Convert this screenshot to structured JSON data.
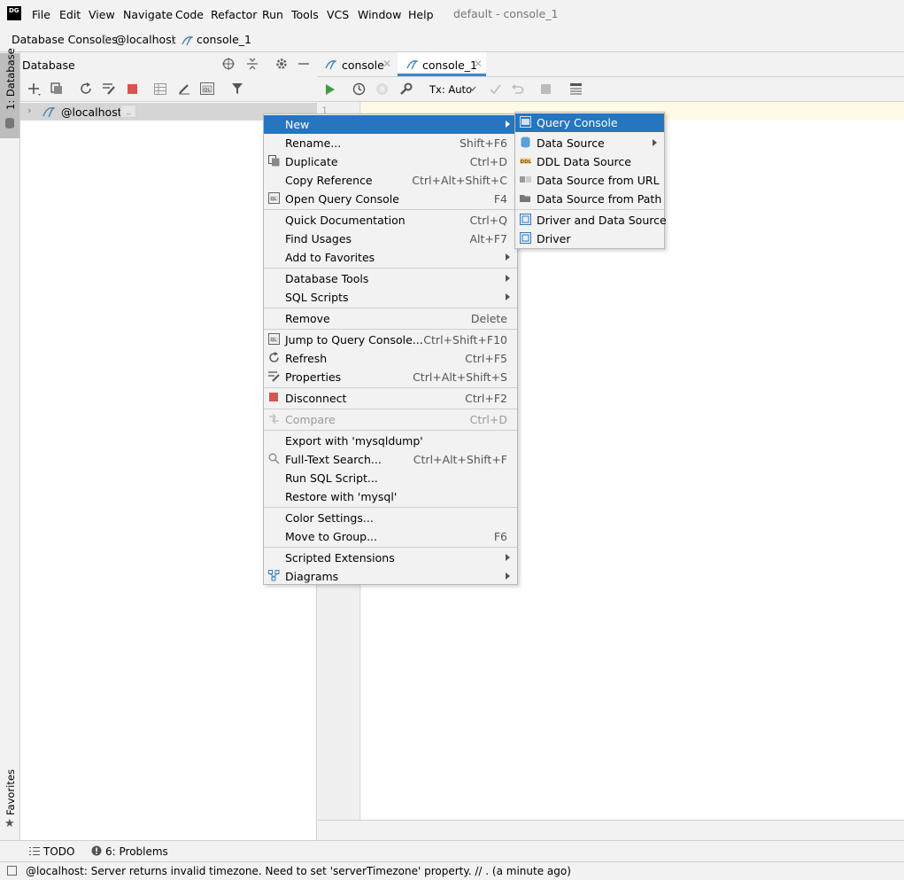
{
  "app": {
    "logo_text": "DG",
    "window_title": "default - console_1"
  },
  "menubar": {
    "items": [
      "File",
      "Edit",
      "View",
      "Navigate",
      "Code",
      "Refactor",
      "Run",
      "Tools",
      "VCS",
      "Window",
      "Help"
    ]
  },
  "breadcrumb": {
    "items": [
      "Database Consoles",
      "@localhost",
      "console_1"
    ]
  },
  "left_stripe": {
    "database_tab": "1: Database",
    "favorites_tab": "Favorites"
  },
  "db_panel": {
    "title": "Database",
    "tree": [
      {
        "label": "@localhost",
        "badge": "_"
      }
    ]
  },
  "editor": {
    "tabs": [
      {
        "label": "console"
      },
      {
        "label": "console_1"
      }
    ],
    "tx_mode": "Tx: Auto",
    "line_numbers": [
      "1"
    ]
  },
  "context_menu": {
    "items": [
      {
        "label": "New",
        "shortcut": "",
        "submenu": true,
        "selected": true
      },
      {
        "label": "Rename...",
        "shortcut": "Shift+F6"
      },
      {
        "label": "Duplicate",
        "shortcut": "Ctrl+D",
        "icon": "duplicate-icon"
      },
      {
        "label": "Copy Reference",
        "shortcut": "Ctrl+Alt+Shift+C"
      },
      {
        "label": "Open Query Console",
        "shortcut": "F4",
        "icon": "ql-icon"
      },
      {
        "label": "Quick Documentation",
        "shortcut": "Ctrl+Q"
      },
      {
        "label": "Find Usages",
        "shortcut": "Alt+F7"
      },
      {
        "label": "Add to Favorites",
        "shortcut": "",
        "submenu": true
      },
      {
        "label": "Database Tools",
        "shortcut": "",
        "submenu": true
      },
      {
        "label": "SQL Scripts",
        "shortcut": "",
        "submenu": true
      },
      {
        "label": "Remove",
        "shortcut": "Delete"
      },
      {
        "label": "Jump to Query Console...",
        "shortcut": "Ctrl+Shift+F10",
        "icon": "ql-icon"
      },
      {
        "label": "Refresh",
        "shortcut": "Ctrl+F5",
        "icon": "refresh-icon"
      },
      {
        "label": "Properties",
        "shortcut": "Ctrl+Alt+Shift+S",
        "icon": "properties-icon"
      },
      {
        "label": "Disconnect",
        "shortcut": "Ctrl+F2",
        "icon": "stop-icon"
      },
      {
        "label": "Compare",
        "shortcut": "Ctrl+D",
        "disabled": true
      },
      {
        "label": "Export with 'mysqldump'",
        "shortcut": ""
      },
      {
        "label": "Full-Text Search...",
        "shortcut": "Ctrl+Alt+Shift+F",
        "icon": "search-icon"
      },
      {
        "label": "Run SQL Script...",
        "shortcut": ""
      },
      {
        "label": "Restore with 'mysql'",
        "shortcut": ""
      },
      {
        "label": "Color Settings...",
        "shortcut": ""
      },
      {
        "label": "Move to Group...",
        "shortcut": "F6"
      },
      {
        "label": "Scripted Extensions",
        "shortcut": "",
        "submenu": true
      },
      {
        "label": "Diagrams",
        "shortcut": "",
        "submenu": true,
        "icon": "diagram-icon"
      }
    ]
  },
  "submenu": {
    "items": [
      {
        "label": "Query Console",
        "selected": true
      },
      {
        "label": "Data Source",
        "submenu": true
      },
      {
        "label": "DDL Data Source"
      },
      {
        "label": "Data Source from URL"
      },
      {
        "label": "Data Source from Path"
      },
      {
        "label": "Driver and Data Source"
      },
      {
        "label": "Driver"
      }
    ]
  },
  "bottom_bar": {
    "todo": "TODO",
    "problems": "6: Problems"
  },
  "status_bar": {
    "message": "@localhost: Server returns invalid timezone. Need to set 'serverTimezone' property. // . (a minute ago)"
  },
  "colors": {
    "selection": "#2675bf",
    "tab_underline": "#4083c9",
    "run_green": "#3e9c3e",
    "stop_red": "#d9534f"
  }
}
